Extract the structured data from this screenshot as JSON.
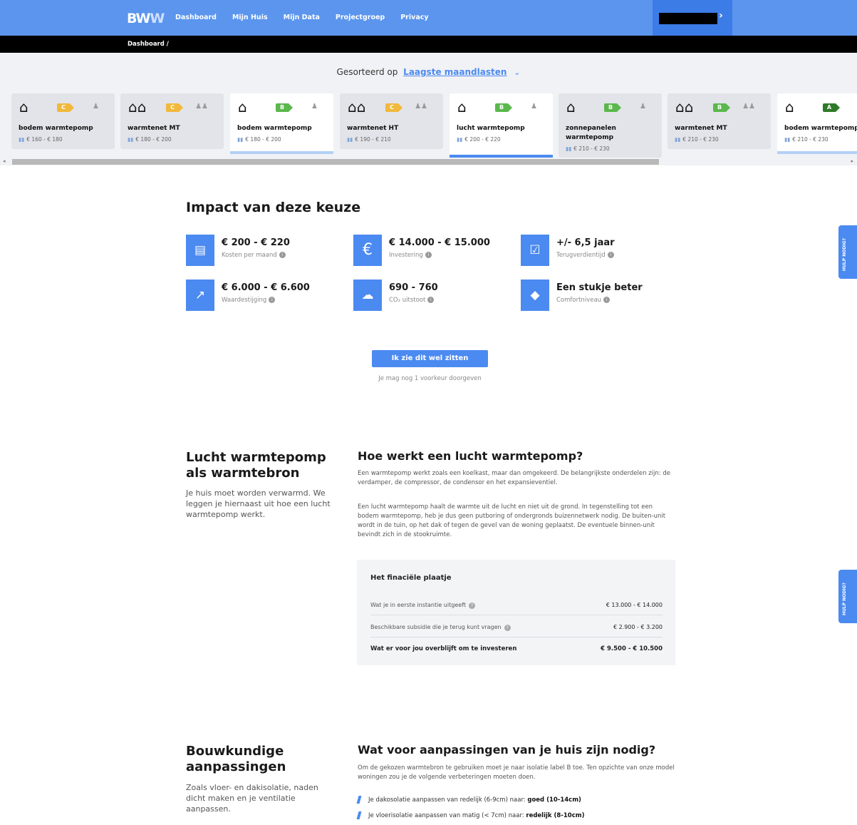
{
  "nav": {
    "logo_a": "BW",
    "logo_b": "W",
    "links": [
      "Dashboard",
      "Mijn Huis",
      "Mijn Data",
      "Projectgroep",
      "Privacy"
    ],
    "chevron": "›"
  },
  "breadcrumb": "Dashboard  /",
  "sort": {
    "prefix": "Gesorteerd op",
    "value": "Laagste maandlasten",
    "chevron": "⌄"
  },
  "cards": [
    {
      "icon": "house-ground-icon",
      "glyph": "⌂",
      "label": "C",
      "name": "bodem warmtepomp",
      "price": "€ 160 - € 180"
    },
    {
      "icon": "heat-network-icon",
      "glyph": "⌂⌂",
      "label": "C",
      "name": "warmtenet MT",
      "price": "€ 180 - € 200"
    },
    {
      "icon": "house-ground-icon",
      "glyph": "⌂",
      "label": "B",
      "name": "bodem warmtepomp",
      "price": "€ 180 - € 200"
    },
    {
      "icon": "heat-network-icon",
      "glyph": "⌂⌂",
      "label": "C",
      "name": "warmtenet HT",
      "price": "€ 190 - € 210"
    },
    {
      "icon": "house-air-icon",
      "glyph": "⌂",
      "label": "B",
      "name": "lucht warmtepomp",
      "price": "€ 200 - € 220"
    },
    {
      "icon": "house-solar-icon",
      "glyph": "⌂",
      "label": "B",
      "name": "zonnepanelen warmtepomp",
      "price": "€ 210 - € 230"
    },
    {
      "icon": "heat-network-icon",
      "glyph": "⌂⌂",
      "label": "B",
      "name": "warmtenet MT",
      "price": "€ 210 - € 230"
    },
    {
      "icon": "house-ground-icon",
      "glyph": "⌂",
      "label": "A",
      "name": "bodem warmtepomp",
      "price": "€ 210 - € 230"
    }
  ],
  "impact": {
    "title": "Impact van deze keuze",
    "stats": [
      {
        "icon": "coins-icon",
        "glyph": "▤",
        "value": "€ 200 - € 220",
        "label": "Kosten per maand"
      },
      {
        "icon": "euro-icon",
        "glyph": "€",
        "value": "€ 14.000 - € 15.000",
        "label": "Investering"
      },
      {
        "icon": "calendar-icon",
        "glyph": "☑",
        "value": "+/- 6,5 jaar",
        "label": "Terugverdientijd"
      },
      {
        "icon": "trend-icon",
        "glyph": "↗",
        "value": "€ 6.000 - € 6.600",
        "label": "Waardestijging"
      },
      {
        "icon": "cloud-icon",
        "glyph": "☁",
        "value": "690 - 760",
        "label": "CO₂ uitstoot"
      },
      {
        "icon": "tag-icon",
        "glyph": "◆",
        "value": "Een stukje beter",
        "label": "Comfortniveau"
      }
    ],
    "cta": "Ik zie dit wel zitten",
    "cta_sub": "Je mag nog 1 voorkeur doorgeven"
  },
  "help": "HULP NODIG?",
  "section1": {
    "title": "Lucht warmtepomp als warmtebron",
    "intro": "Je huis moet worden verwarmd. We leggen je hiernaast uit hoe een lucht warmtepomp werkt.",
    "heading": "Hoe werkt een lucht warmtepomp?",
    "p1": "Een warmtepomp werkt zoals een koelkast, maar dan omgekeerd. De belangrijkste onderdelen zijn: de verdamper, de compressor, de condensor en het expansieventiel.",
    "p2": "Een lucht warmtepomp haalt de warmte uit de lucht en niet uit de grond. In tegenstelling tot een bodem warmtepomp, heb je dus geen putboring of ondergronds buizennetwerk nodig. De buiten-unit wordt in de tuin, op het dak of tegen de gevel van de woning geplaatst. De eventuele binnen-unit bevindt zich in de stookruimte."
  },
  "finance": {
    "title": "Het finaciële plaatje",
    "rows": [
      {
        "label": "Wat je in eerste instantie uitgeeft",
        "value": "€ 13.000 - € 14.000"
      },
      {
        "label": "Beschikbare subsidie die je terug kunt vragen",
        "value": "€ 2.900 - € 3.200"
      },
      {
        "label": "Wat er voor jou overblijft om te investeren",
        "value": "€ 9.500 - € 10.500"
      }
    ]
  },
  "section2": {
    "title": "Bouwkundige aanpassingen",
    "intro": "Zoals vloer- en dakisolatie, naden dicht maken en je ventilatie aanpassen.",
    "heading": "Wat voor aanpassingen van je huis zijn nodig?",
    "p1": "Om de gekozen warmtebron te gebruiken moet je naar isolatie label B toe. Ten opzichte van onze model woningen zou je de volgende verbeteringen moeten doen.",
    "items": [
      {
        "text": "Je dakosolatie aanpassen van redelijk (6-9cm) naar: ",
        "bold": "goed (10-14cm)"
      },
      {
        "text": "Je vloerisolatie aanpassen van matig (< 7cm) naar: ",
        "bold": "redelijk (8-10cm)"
      }
    ]
  },
  "colors": {
    "accent": "#4b8af0",
    "nav": "#5b95ee",
    "label_c": "#f1b83b",
    "label_b": "#5bb84c",
    "label_a": "#2e7a2a"
  }
}
